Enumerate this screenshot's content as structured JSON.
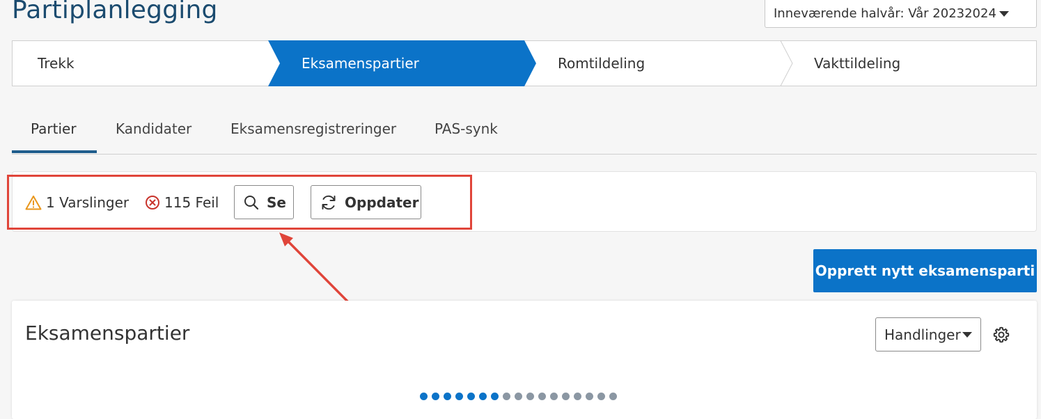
{
  "page": {
    "title": "Partiplanlegging",
    "semester_select": "Inneværende halvår: Vår 20232024"
  },
  "stepper": {
    "steps": [
      {
        "label": "Trekk",
        "active": false
      },
      {
        "label": "Eksamenspartier",
        "active": true
      },
      {
        "label": "Romtildeling",
        "active": false
      },
      {
        "label": "Vakttildeling",
        "active": false
      }
    ],
    "active_color": "#0b73c8"
  },
  "tabs": [
    {
      "label": "Partier",
      "active": true
    },
    {
      "label": "Kandidater",
      "active": false
    },
    {
      "label": "Eksamensregistreringer",
      "active": false
    },
    {
      "label": "PAS-synk",
      "active": false
    }
  ],
  "status": {
    "warnings": "1 Varslinger",
    "errors": "115 Feil",
    "view_button": "Se",
    "refresh_button": "Oppdater",
    "warning_icon": "warning-triangle-icon",
    "error_icon": "error-circle-x-icon",
    "warning_color": "#e9961b",
    "error_color": "#c8332b"
  },
  "annotation": {
    "color": "#e0453a"
  },
  "create_button": "Opprett nytt eksamensparti",
  "card": {
    "title": "Eksamenspartier",
    "actions_select": "Handlinger",
    "settings_icon": "gear-icon",
    "loader": {
      "active_dots": 7,
      "total_dots": 17
    }
  }
}
